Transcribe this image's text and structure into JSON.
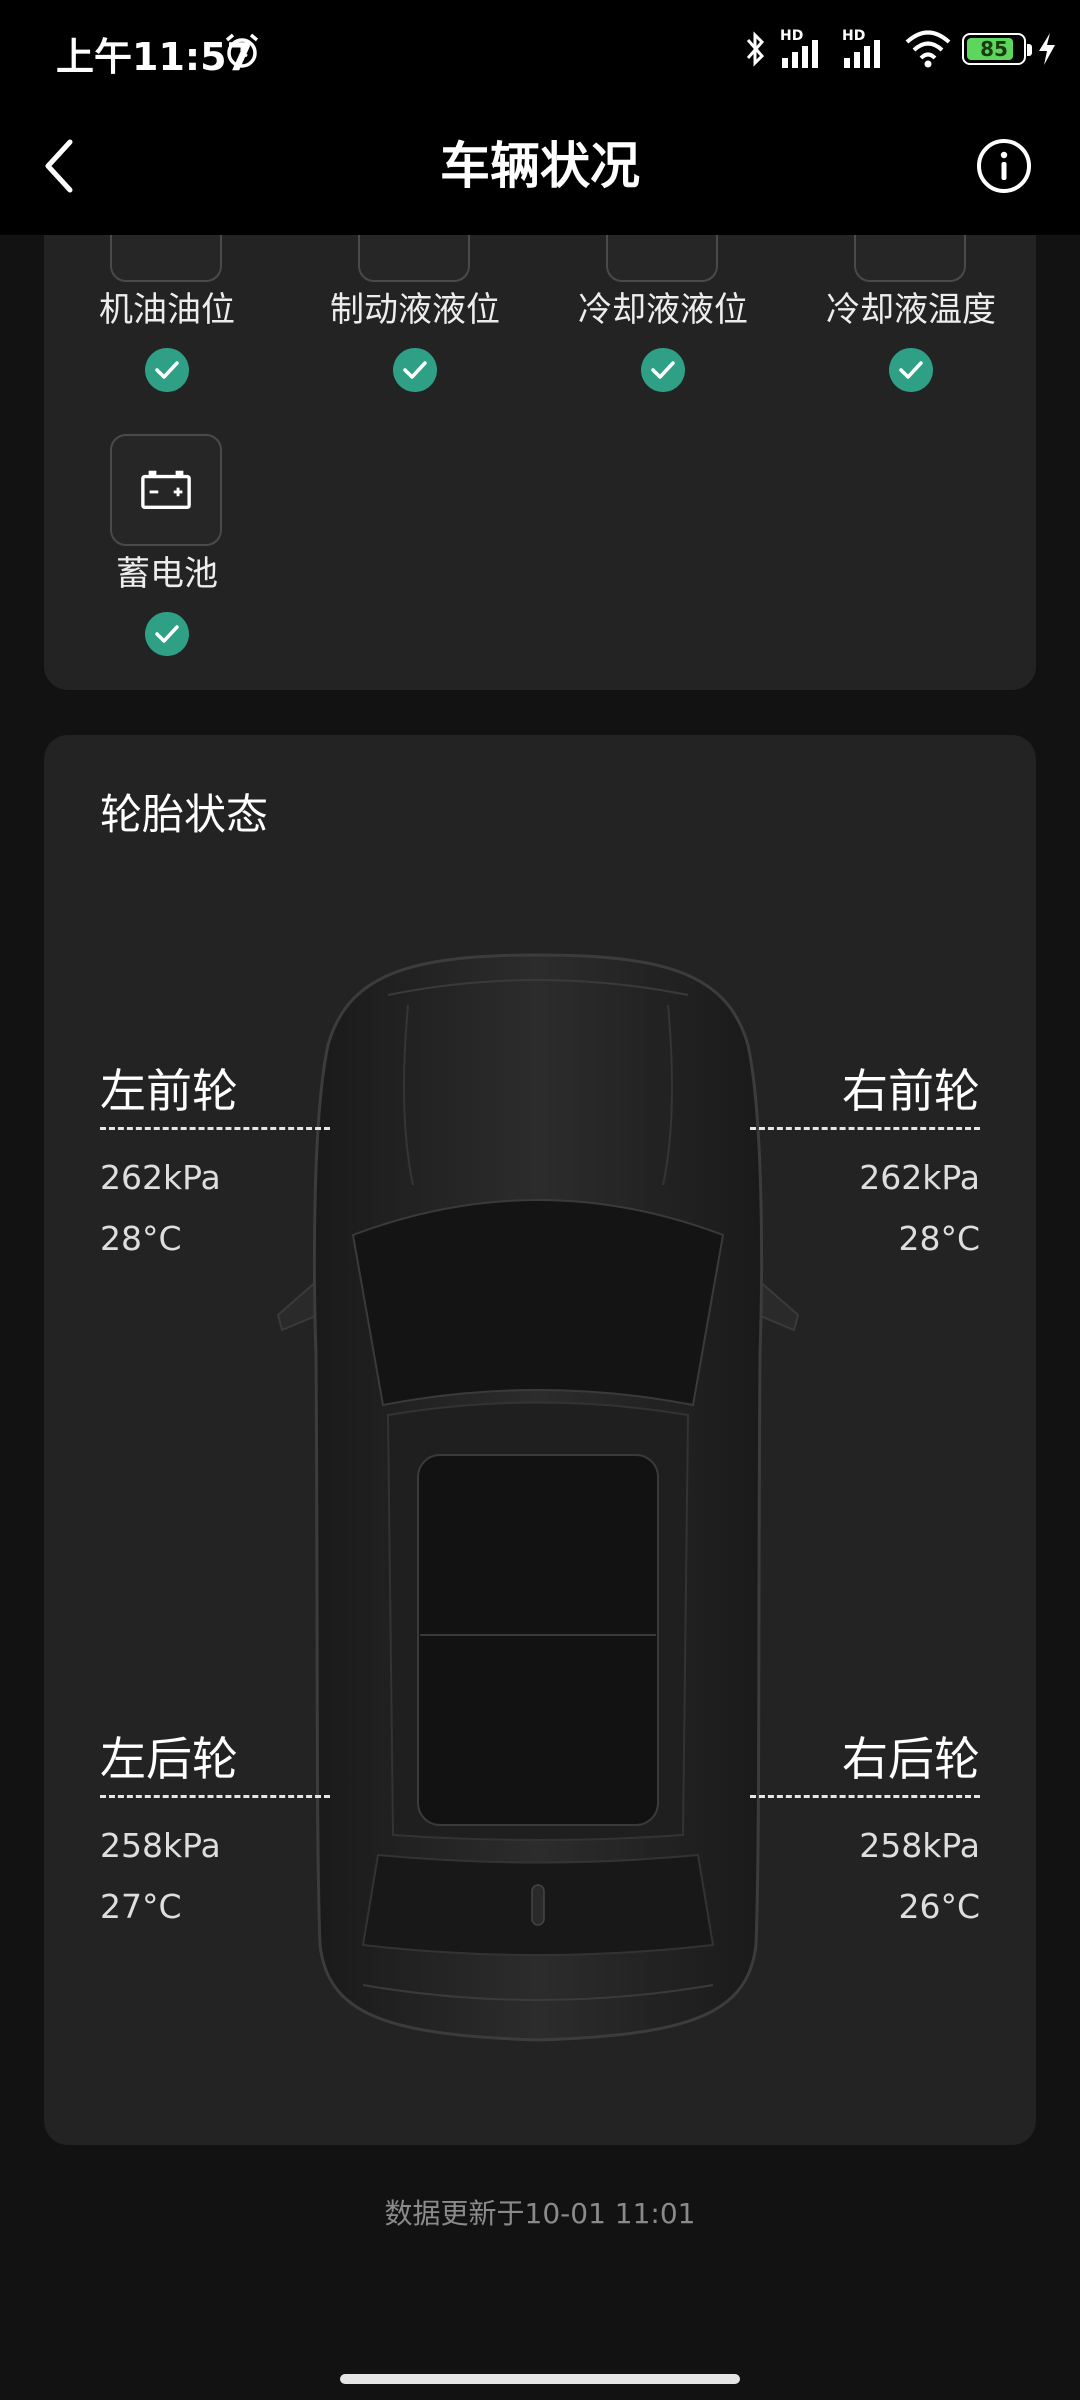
{
  "status_bar": {
    "time": "上午11:57",
    "battery": "85",
    "signal_hd_1": "HD",
    "signal_hd_2": "HD"
  },
  "header": {
    "title": "车辆状况"
  },
  "fluids": [
    {
      "label": "机油油位",
      "status": "ok"
    },
    {
      "label": "制动液液位",
      "status": "ok"
    },
    {
      "label": "冷却液液位",
      "status": "ok"
    },
    {
      "label": "冷却液温度",
      "status": "ok"
    },
    {
      "label": "蓄电池",
      "status": "ok"
    }
  ],
  "tires": {
    "title": "轮胎状态",
    "front_left": {
      "label": "左前轮",
      "pressure": "262kPa",
      "temp": "28°C"
    },
    "front_right": {
      "label": "右前轮",
      "pressure": "262kPa",
      "temp": "28°C"
    },
    "rear_left": {
      "label": "左后轮",
      "pressure": "258kPa",
      "temp": "27°C"
    },
    "rear_right": {
      "label": "右后轮",
      "pressure": "258kPa",
      "temp": "26°C"
    }
  },
  "footer": {
    "update_text": "数据更新于10-01 11:01"
  },
  "colors": {
    "check_green": "#2f9f86",
    "card_bg": "#232323",
    "page_bg": "#121212"
  }
}
